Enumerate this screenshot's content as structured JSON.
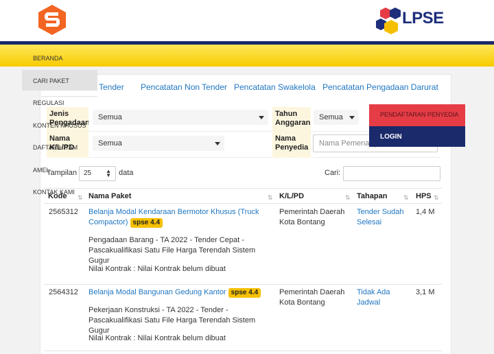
{
  "header": {
    "brand_logo_icon": "s-cube-logo-icon",
    "lpse_logo_text": "LPSE"
  },
  "nav": {
    "items": [
      {
        "label": "BERANDA"
      },
      {
        "label": "CARI PAKET"
      },
      {
        "label": "REGULASI"
      },
      {
        "label": "KONTEN KHUSUS"
      },
      {
        "label": "DAFTAR HITAM"
      },
      {
        "label": "AMEL"
      },
      {
        "label": "KONTAK KAMI"
      }
    ]
  },
  "tabs": [
    {
      "label": "Tender"
    },
    {
      "label": "Pencatatan Non Tender"
    },
    {
      "label": "Pencatatan Swakelola"
    },
    {
      "label": "Pencatatan Pengadaan Darurat"
    }
  ],
  "filters": {
    "jenis_pengadaan_label": "Jenis Pengadaan",
    "jenis_pengadaan_value": "Semua",
    "tahun_anggaran_label": "Tahun Anggaran",
    "tahun_anggaran_value": "Semua",
    "nama_klpd_label": "Nama K/L/PD",
    "nama_klpd_value": "Semua",
    "nama_penyedia_label": "Nama Penyedia",
    "nama_penyedia_placeholder": "Nama Pemenang"
  },
  "table_controls": {
    "show_label": "Tampilan",
    "page_size": "25",
    "data_label": "data",
    "search_label": "Cari:"
  },
  "table": {
    "headers": {
      "kode": "Kode",
      "nama_paket": "Nama Paket",
      "klpd": "K/L/PD",
      "tahapan": "Tahapan",
      "hps": "HPS"
    },
    "rows": [
      {
        "kode": "2565312",
        "title_line1": "Belanja Modal Kendaraan Bermotor Khusus (Truck",
        "title_line2": "Compactor)",
        "badge": "spse 4.4",
        "desc_line1": "Pengadaan Barang - TA 2022 - Tender Cepat -",
        "desc_line2": "Pascakualifikasi Satu File Harga Terendah Sistem Gugur",
        "nilai": "Nilai Kontrak : Nilai Kontrak belum dibuat",
        "klpd_line1": "Pemerintah Daerah",
        "klpd_line2": "Kota Bontang",
        "tahapan_line1": "Tender Sudah",
        "tahapan_line2": "Selesai",
        "hps": "1,4 M"
      },
      {
        "kode": "2564312",
        "title_line1": "Belanja Modal Bangunan Gedung Kantor",
        "badge": "spse 4.4",
        "desc_line1": "Pekerjaan Konstruksi - TA 2022 - Tender -",
        "desc_line2": "Pascakualifikasi Satu File Harga Terendah Sistem Gugur",
        "nilai": "Nilai Kontrak : Nilai Kontrak belum dibuat",
        "klpd_line1": "Pemerintah Daerah",
        "klpd_line2": "Kota Bontang",
        "tahapan_line1": "Tidak Ada",
        "tahapan_line2": "Jadwal",
        "hps": "3,1 M"
      }
    ]
  },
  "account_menu": {
    "register_label": "PENDAFTARAN PENYEDIA",
    "login_label": "LOGIN"
  },
  "colors": {
    "yellow_bar": "#f7cb00",
    "navy": "#1b2a6b",
    "link_blue": "#1f76c2",
    "register_red": "#e63c46",
    "badge_yellow": "#f5c000"
  }
}
